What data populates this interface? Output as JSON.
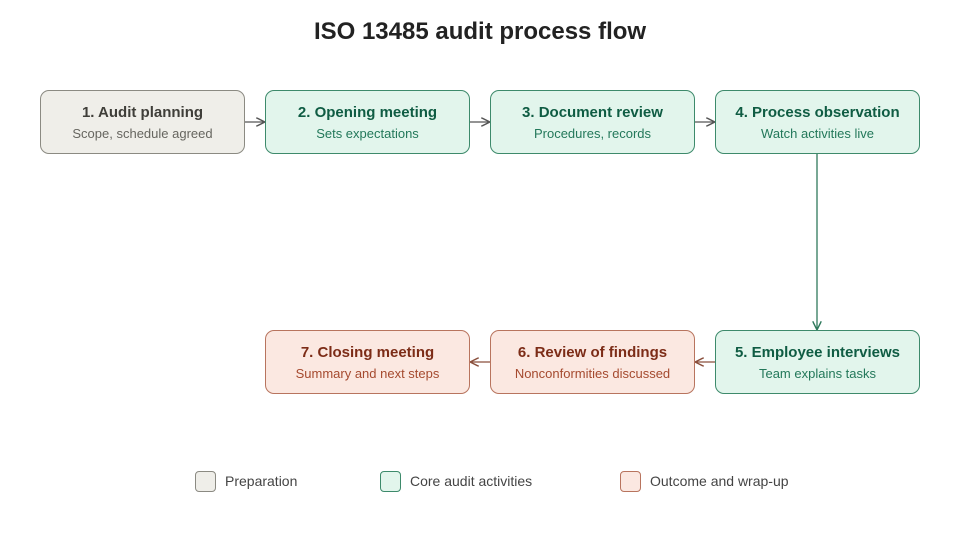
{
  "title": "ISO 13485 audit process flow",
  "colors": {
    "preparation_fill": "#efeee9",
    "preparation_border": "#8b8a82",
    "core_fill": "#e2f5ec",
    "core_border": "#3d8a6b",
    "outcome_fill": "#fbe8e1",
    "outcome_border": "#b8745e",
    "arrow_grey": "#555555",
    "arrow_green": "#2f7a5c",
    "arrow_brown": "#8a4f3c"
  },
  "steps": [
    {
      "title": "1. Audit planning",
      "subtitle": "Scope, schedule agreed",
      "category": "Preparation"
    },
    {
      "title": "2. Opening meeting",
      "subtitle": "Sets expectations",
      "category": "Core audit activities"
    },
    {
      "title": "3. Document review",
      "subtitle": "Procedures, records",
      "category": "Core audit activities"
    },
    {
      "title": "4. Process observation",
      "subtitle": "Watch activities live",
      "category": "Core audit activities"
    },
    {
      "title": "5. Employee interviews",
      "subtitle": "Team explains tasks",
      "category": "Core audit activities"
    },
    {
      "title": "6. Review of findings",
      "subtitle": "Nonconformities discussed",
      "category": "Outcome and wrap-up"
    },
    {
      "title": "7. Closing meeting",
      "subtitle": "Summary and next steps",
      "category": "Outcome and wrap-up"
    }
  ],
  "flow": [
    {
      "from": "1. Audit planning",
      "to": "2. Opening meeting"
    },
    {
      "from": "2. Opening meeting",
      "to": "3. Document review"
    },
    {
      "from": "3. Document review",
      "to": "4. Process observation"
    },
    {
      "from": "4. Process observation",
      "to": "5. Employee interviews"
    },
    {
      "from": "5. Employee interviews",
      "to": "6. Review of findings"
    },
    {
      "from": "6. Review of findings",
      "to": "7. Closing meeting"
    }
  ],
  "legend": [
    {
      "label": "Preparation"
    },
    {
      "label": "Core audit activities"
    },
    {
      "label": "Outcome and wrap-up"
    }
  ]
}
